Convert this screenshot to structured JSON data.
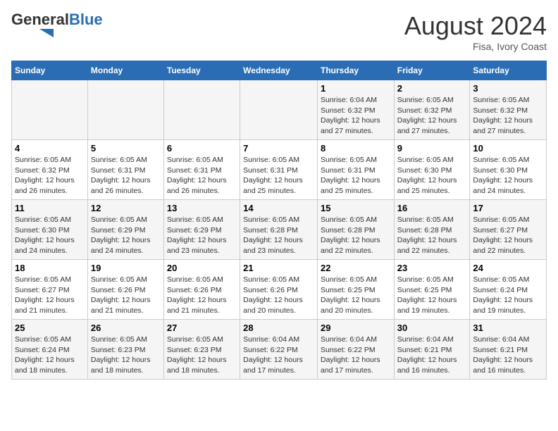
{
  "header": {
    "logo_general": "General",
    "logo_blue": "Blue",
    "month_year": "August 2024",
    "location": "Fisa, Ivory Coast"
  },
  "weekdays": [
    "Sunday",
    "Monday",
    "Tuesday",
    "Wednesday",
    "Thursday",
    "Friday",
    "Saturday"
  ],
  "weeks": [
    [
      {
        "day": "",
        "info": ""
      },
      {
        "day": "",
        "info": ""
      },
      {
        "day": "",
        "info": ""
      },
      {
        "day": "",
        "info": ""
      },
      {
        "day": "1",
        "info": "Sunrise: 6:04 AM\nSunset: 6:32 PM\nDaylight: 12 hours\nand 27 minutes."
      },
      {
        "day": "2",
        "info": "Sunrise: 6:05 AM\nSunset: 6:32 PM\nDaylight: 12 hours\nand 27 minutes."
      },
      {
        "day": "3",
        "info": "Sunrise: 6:05 AM\nSunset: 6:32 PM\nDaylight: 12 hours\nand 27 minutes."
      }
    ],
    [
      {
        "day": "4",
        "info": "Sunrise: 6:05 AM\nSunset: 6:32 PM\nDaylight: 12 hours\nand 26 minutes."
      },
      {
        "day": "5",
        "info": "Sunrise: 6:05 AM\nSunset: 6:31 PM\nDaylight: 12 hours\nand 26 minutes."
      },
      {
        "day": "6",
        "info": "Sunrise: 6:05 AM\nSunset: 6:31 PM\nDaylight: 12 hours\nand 26 minutes."
      },
      {
        "day": "7",
        "info": "Sunrise: 6:05 AM\nSunset: 6:31 PM\nDaylight: 12 hours\nand 25 minutes."
      },
      {
        "day": "8",
        "info": "Sunrise: 6:05 AM\nSunset: 6:31 PM\nDaylight: 12 hours\nand 25 minutes."
      },
      {
        "day": "9",
        "info": "Sunrise: 6:05 AM\nSunset: 6:30 PM\nDaylight: 12 hours\nand 25 minutes."
      },
      {
        "day": "10",
        "info": "Sunrise: 6:05 AM\nSunset: 6:30 PM\nDaylight: 12 hours\nand 24 minutes."
      }
    ],
    [
      {
        "day": "11",
        "info": "Sunrise: 6:05 AM\nSunset: 6:30 PM\nDaylight: 12 hours\nand 24 minutes."
      },
      {
        "day": "12",
        "info": "Sunrise: 6:05 AM\nSunset: 6:29 PM\nDaylight: 12 hours\nand 24 minutes."
      },
      {
        "day": "13",
        "info": "Sunrise: 6:05 AM\nSunset: 6:29 PM\nDaylight: 12 hours\nand 23 minutes."
      },
      {
        "day": "14",
        "info": "Sunrise: 6:05 AM\nSunset: 6:28 PM\nDaylight: 12 hours\nand 23 minutes."
      },
      {
        "day": "15",
        "info": "Sunrise: 6:05 AM\nSunset: 6:28 PM\nDaylight: 12 hours\nand 22 minutes."
      },
      {
        "day": "16",
        "info": "Sunrise: 6:05 AM\nSunset: 6:28 PM\nDaylight: 12 hours\nand 22 minutes."
      },
      {
        "day": "17",
        "info": "Sunrise: 6:05 AM\nSunset: 6:27 PM\nDaylight: 12 hours\nand 22 minutes."
      }
    ],
    [
      {
        "day": "18",
        "info": "Sunrise: 6:05 AM\nSunset: 6:27 PM\nDaylight: 12 hours\nand 21 minutes."
      },
      {
        "day": "19",
        "info": "Sunrise: 6:05 AM\nSunset: 6:26 PM\nDaylight: 12 hours\nand 21 minutes."
      },
      {
        "day": "20",
        "info": "Sunrise: 6:05 AM\nSunset: 6:26 PM\nDaylight: 12 hours\nand 21 minutes."
      },
      {
        "day": "21",
        "info": "Sunrise: 6:05 AM\nSunset: 6:26 PM\nDaylight: 12 hours\nand 20 minutes."
      },
      {
        "day": "22",
        "info": "Sunrise: 6:05 AM\nSunset: 6:25 PM\nDaylight: 12 hours\nand 20 minutes."
      },
      {
        "day": "23",
        "info": "Sunrise: 6:05 AM\nSunset: 6:25 PM\nDaylight: 12 hours\nand 19 minutes."
      },
      {
        "day": "24",
        "info": "Sunrise: 6:05 AM\nSunset: 6:24 PM\nDaylight: 12 hours\nand 19 minutes."
      }
    ],
    [
      {
        "day": "25",
        "info": "Sunrise: 6:05 AM\nSunset: 6:24 PM\nDaylight: 12 hours\nand 18 minutes."
      },
      {
        "day": "26",
        "info": "Sunrise: 6:05 AM\nSunset: 6:23 PM\nDaylight: 12 hours\nand 18 minutes."
      },
      {
        "day": "27",
        "info": "Sunrise: 6:05 AM\nSunset: 6:23 PM\nDaylight: 12 hours\nand 18 minutes."
      },
      {
        "day": "28",
        "info": "Sunrise: 6:04 AM\nSunset: 6:22 PM\nDaylight: 12 hours\nand 17 minutes."
      },
      {
        "day": "29",
        "info": "Sunrise: 6:04 AM\nSunset: 6:22 PM\nDaylight: 12 hours\nand 17 minutes."
      },
      {
        "day": "30",
        "info": "Sunrise: 6:04 AM\nSunset: 6:21 PM\nDaylight: 12 hours\nand 16 minutes."
      },
      {
        "day": "31",
        "info": "Sunrise: 6:04 AM\nSunset: 6:21 PM\nDaylight: 12 hours\nand 16 minutes."
      }
    ]
  ]
}
